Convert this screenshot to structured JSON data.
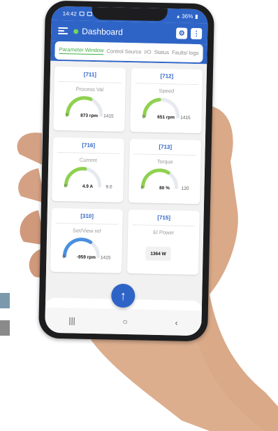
{
  "status_bar": {
    "time": "14:42",
    "battery": "36%"
  },
  "app_bar": {
    "title": "Dashboard",
    "settings_icon": "settings-icon",
    "more_icon": "more-vertical-icon"
  },
  "tabs": [
    {
      "label": "Parameter Window",
      "active": true
    },
    {
      "label": "Control Source",
      "active": false
    },
    {
      "label": "I/O",
      "active": false
    },
    {
      "label": "Status",
      "active": false
    },
    {
      "label": "Faults/ logs",
      "active": false
    }
  ],
  "cards": [
    {
      "id": "[711]",
      "label": "Process Val",
      "min": "0",
      "value": "873 rpm",
      "max": "1415",
      "level": 0.62,
      "color": "#8fd14f"
    },
    {
      "id": "[712]",
      "label": "Speed",
      "min": "0",
      "value": "651 rpm",
      "max": "1415",
      "level": 0.46,
      "color": "#8fd14f"
    },
    {
      "id": "[716]",
      "label": "Current",
      "min": "0",
      "value": "4.9 A",
      "max": "9.0",
      "level": 0.54,
      "color": "#8fd14f"
    },
    {
      "id": "[713]",
      "label": "Torque",
      "min": "0",
      "value": "80 %",
      "max": "120",
      "level": 0.67,
      "color": "#8fd14f"
    },
    {
      "id": "[310]",
      "label": "Set/View ref",
      "min": "0",
      "value": "-959 rpm",
      "max": "1415",
      "level": 0.68,
      "color": "#4a8fe0"
    },
    {
      "id": "[715]",
      "label": "El Power",
      "value": "1364 W"
    }
  ],
  "nav": {
    "recents": "|||",
    "home": "○",
    "back": "‹"
  },
  "fab_icon": "arrow-up-icon"
}
